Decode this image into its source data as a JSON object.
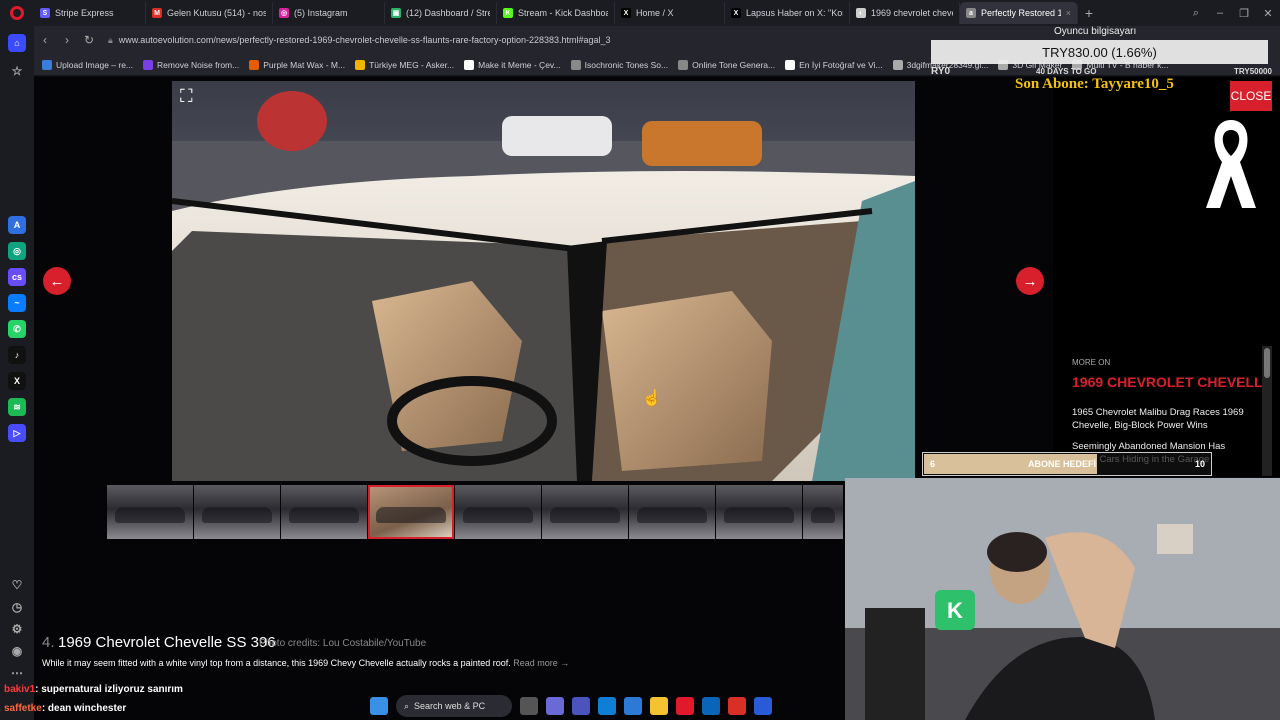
{
  "tabs": [
    {
      "label": "Stripe Express",
      "color": "#635bff",
      "glyph": "S",
      "active": false
    },
    {
      "label": "Gelen Kutusu (514) - nosr",
      "color": "#d93025",
      "glyph": "M",
      "active": false
    },
    {
      "label": "(5) Instagram",
      "color": "#d6249f",
      "glyph": "◎",
      "active": false
    },
    {
      "label": "(12) Dashboard / Streamla",
      "color": "#2bb36b",
      "glyph": "▣",
      "active": false
    },
    {
      "label": "Stream - Kick Dashboard",
      "color": "#53fc18",
      "glyph": "K",
      "active": false
    },
    {
      "label": "Home / X",
      "color": "#000000",
      "glyph": "X",
      "active": false
    },
    {
      "label": "Lapsus Haber on X: \"Kont",
      "color": "#000000",
      "glyph": "X",
      "active": false
    },
    {
      "label": "1969 chevrolet chevelle ss",
      "color": "#cccccc",
      "glyph": "◐",
      "active": false
    },
    {
      "label": "Perfectly Restored 1969 C",
      "color": "#888888",
      "glyph": "a",
      "active": true
    }
  ],
  "address": {
    "url": "www.autoevolution.com/news/perfectly-restored-1969-chevrolet-chevelle-ss-flaunts-rare-factory-option-228383.html#agal_3"
  },
  "bookmarks": [
    {
      "label": "Upload Image – re...",
      "color": "#3b7ddd"
    },
    {
      "label": "Remove Noise from...",
      "color": "#7b3fe4"
    },
    {
      "label": "Purple Mat Wax - M...",
      "color": "#e65c00"
    },
    {
      "label": "Türkiye MEG - Asker...",
      "color": "#f2b400"
    },
    {
      "label": "Make it Meme - Çev...",
      "color": "#ffffff"
    },
    {
      "label": "Isochronic Tones So...",
      "color": "#888888"
    },
    {
      "label": "Online Tone Genera...",
      "color": "#888888"
    },
    {
      "label": "En İyi Fotoğraf ve Vi...",
      "color": "#ffffff"
    },
    {
      "label": "3dgifmaker28349.gi...",
      "color": "#aaaaaa"
    },
    {
      "label": "3D Gif Maker",
      "color": "#aaaaaa"
    },
    {
      "label": "Multi TV - B haber k...",
      "color": "#aaaaaa"
    }
  ],
  "gallery": {
    "caption_number": "4.",
    "caption_title": "1969 Chevrolet Chevelle SS 396",
    "photo_credit": "Photo credits: Lou Costabile/YouTube",
    "caption_body": "While it may seem fitted with a white vinyl top from a distance, this 1969 Chevy Chevelle actually rocks a painted roof.",
    "read_more": "Read more →",
    "prev_icon": "←",
    "next_icon": "→",
    "thumbnail_count": 9,
    "selected_thumbnail": 4
  },
  "side_panel": {
    "close_label": "CLOSE",
    "more_on_label": "MORE ON",
    "more_on_title": "1969 CHEVROLET CHEVELLE",
    "related": [
      "1965 Chevrolet Malibu Drag Races 1969 Chevelle, Big-Block Power Wins",
      "Seemingly Abandoned Mansion Has Three Cars Hiding in the Garage"
    ]
  },
  "stream_overlay": {
    "device_label": "Oyuncu bilgisayarı",
    "stock_ticker": "TRY830.00 (1.66%)",
    "goal_left": "RY0",
    "goal_mid": "40 DAYS TO GO",
    "goal_right": "TRY50000",
    "last_sub": "Son Abone: Tayyare10_5",
    "sub_goal_start": "6",
    "sub_goal_label": "ABONE HEDEFİ",
    "sub_goal_end": "10",
    "sub_goal_progress": 0.6
  },
  "chat": [
    {
      "user": "bakiv1",
      "message": ": supernatural izliyoruz sanırım"
    },
    {
      "user": "saffetke",
      "message": ": dean winchester"
    }
  ],
  "taskbar": {
    "search_placeholder": "Search web & PC"
  },
  "colors": {
    "accent": "#d8202c",
    "gold": "#f4c20d"
  }
}
